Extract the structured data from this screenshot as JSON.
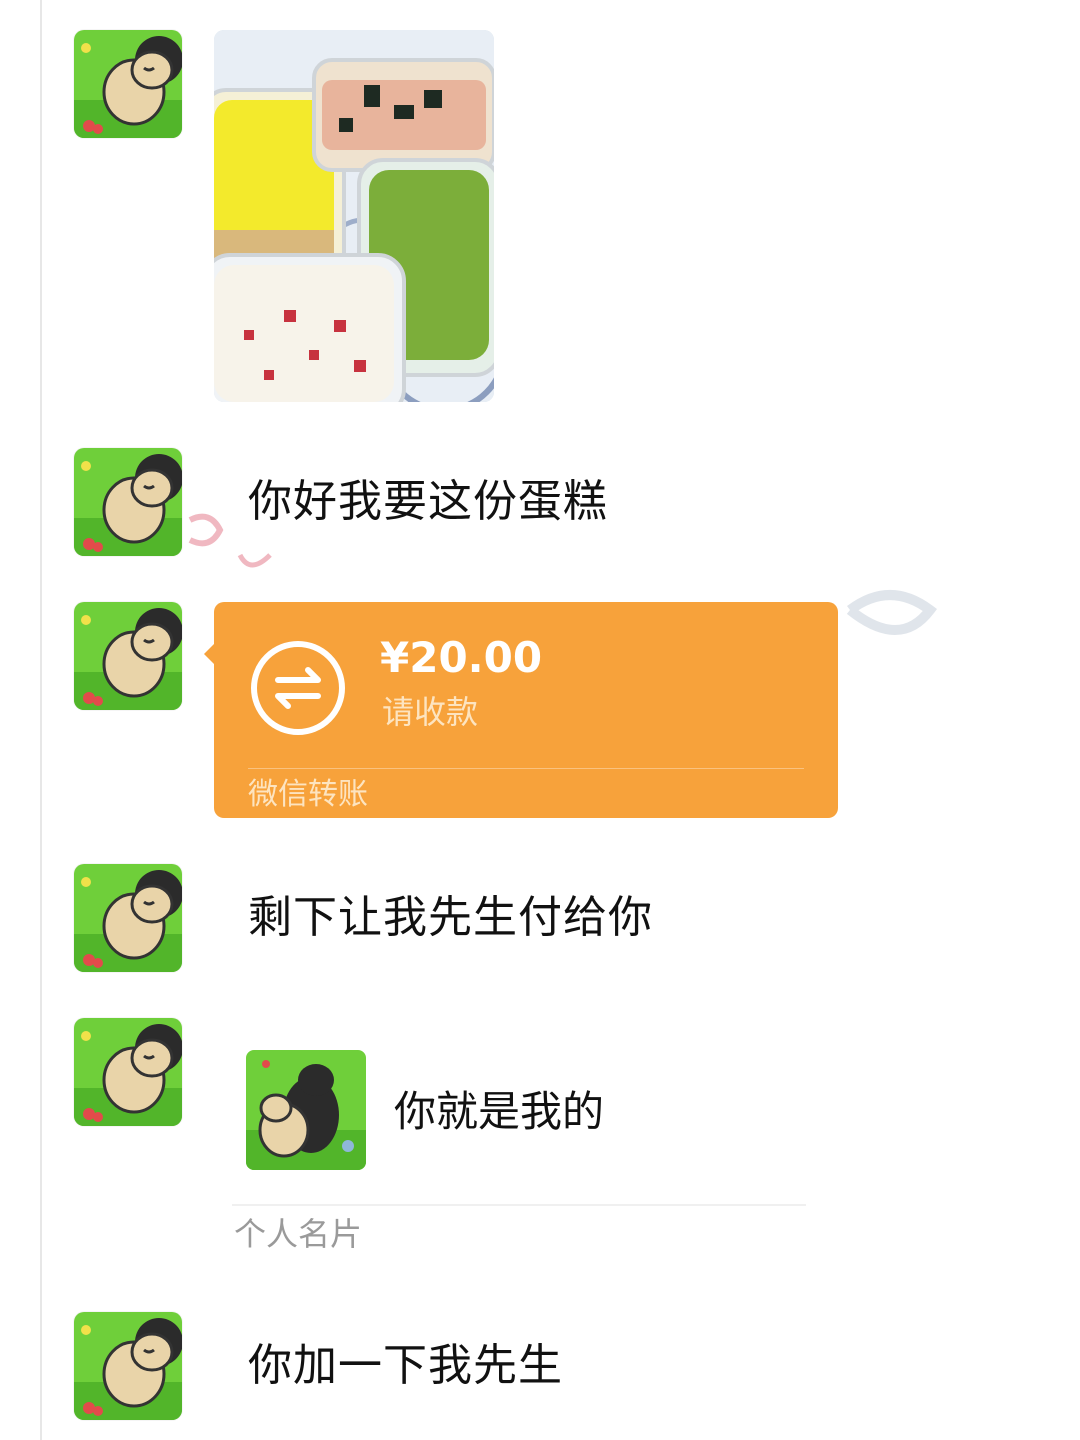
{
  "messages": {
    "text1": "你好我要这份蛋糕",
    "text2": "剩下让我先生付给你",
    "text3": "你加一下我先生"
  },
  "transfer": {
    "amount": "¥20.00",
    "subtitle": "请收款",
    "footer": "微信转账",
    "color": "#f7a23b",
    "icon": "transfer-arrows-icon"
  },
  "card": {
    "name": "你就是我的",
    "type": "个人名片"
  },
  "image_message": {
    "description": "cake-boxes-photo"
  }
}
